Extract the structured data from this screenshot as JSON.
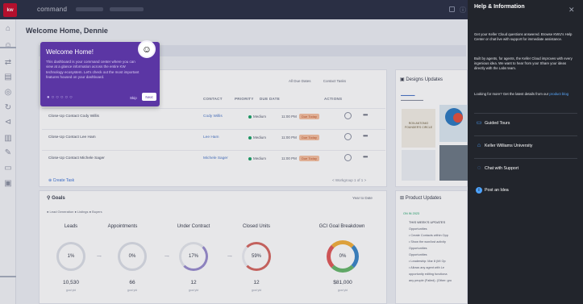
{
  "topbar": {
    "logo": "kw",
    "app_name": "command"
  },
  "page": {
    "title": "Welcome Home, Dennie"
  },
  "popup": {
    "title": "Welcome Home!",
    "body": "This dashboard is your command center where you can view at a glance information across the entire KW technology ecosystem. Let's check out the most important features housed on your dashboard.",
    "skip": "Skip",
    "next": "Next"
  },
  "tasks": {
    "filters": [
      "All Due Dates",
      "Contact Tasks"
    ],
    "columns": [
      "CONTACT",
      "PRIORITY",
      "DUE DATE",
      "ACTIONS"
    ],
    "rows": [
      {
        "name": "Close-Up Contact Cody Willis",
        "contact": "Cody Willis",
        "priority": "Medium",
        "due": "11:00 PM",
        "badge": "Due Today"
      },
      {
        "name": "Close-Up Contact Lee Ham",
        "contact": "Lee Ham",
        "priority": "Medium",
        "due": "11:00 PM",
        "badge": "Due Today"
      },
      {
        "name": "Close-Up Contact Michele Sager",
        "contact": "Michele Sager",
        "priority": "Medium",
        "due": "11:00 PM",
        "badge": "Due Today"
      }
    ],
    "create": "Create Task",
    "pager": "< Workgroup 1 of 1 >"
  },
  "goals": {
    "title": "Goals",
    "range": "Year to Date",
    "legend": "● Lead Generation  ● Listings  ● Buyers",
    "items": [
      {
        "name": "Leads",
        "pct": "1%",
        "value": "10,530",
        "caption": "goal ytd"
      },
      {
        "name": "Appointments",
        "pct": "0%",
        "value": "66",
        "caption": "goal ytd"
      },
      {
        "name": "Under Contract",
        "pct": "17%",
        "value": "12",
        "caption": "goal ytd"
      },
      {
        "name": "Closed Units",
        "pct": "59%",
        "value": "12",
        "caption": "goal ytd"
      },
      {
        "name": "GCI Goal Breakdown",
        "pct": "0%",
        "value": "$81,000",
        "caption": "goal ytd"
      }
    ]
  },
  "designs": {
    "title": "Designs Updates",
    "thumb_text": "RON ANTONIO FOUNDER'S CIRCLE"
  },
  "product": {
    "title": "Product Updates",
    "tag": "ON IN 2023",
    "head": "THIS WEEK'S UPDATES",
    "lines": [
      "Opportunities",
      "• Create Contacts within Opp",
      "• Show the won/lost activity",
      "Opportunities",
      "Opportunities",
      "• Leadership: Mar 8 (MI Op",
      "• Allows any agent with Le",
      "opportunity editing functiona",
      "any people (Failed). (Other: gro"
    ]
  },
  "help": {
    "title": "Help & Information",
    "close": "✕",
    "p1": "Get your Keller Cloud questions answered. Browse KWU's Help Center or chat live with support for immediate assistance.",
    "p2": "Built by agents, for agents, the Keller Cloud improves with every ingenious idea. We want to hear from you! Share your ideas directly with the Labs team.",
    "p3_prefix": "Looking for more? Get the latest details from our",
    "p3_link": "product blog",
    "items": [
      {
        "label": "Guided Tours",
        "icon": "tour-icon"
      },
      {
        "label": "Keller Williams University",
        "icon": "graduation-cap-icon"
      },
      {
        "label": "Chat with Support",
        "icon": "chat-icon"
      }
    ],
    "post": "Post an Idea"
  }
}
